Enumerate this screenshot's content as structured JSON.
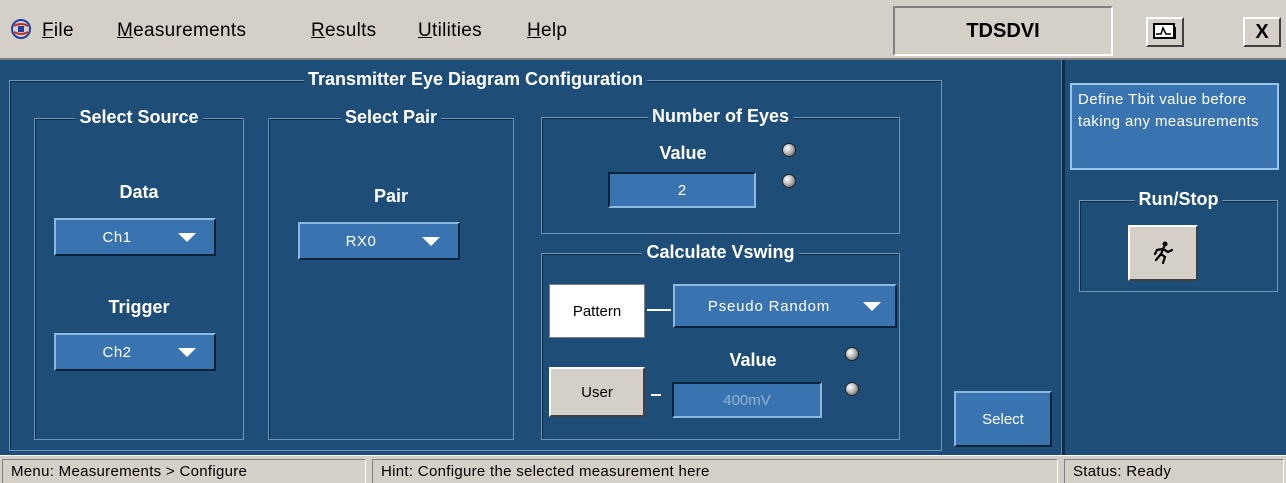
{
  "menu": {
    "items": [
      {
        "underline": "F",
        "rest": "ile"
      },
      {
        "underline": "M",
        "rest": "easurements"
      },
      {
        "underline": "R",
        "rest": "esults"
      },
      {
        "underline": "U",
        "rest": "tilities"
      },
      {
        "underline": "H",
        "rest": "elp"
      }
    ],
    "app_title": "TDSDVI",
    "close_label": "X"
  },
  "main": {
    "config_title": "Transmitter Eye Diagram Configuration",
    "select_source": {
      "title": "Select Source",
      "data_label": "Data",
      "data_value": "Ch1",
      "trigger_label": "Trigger",
      "trigger_value": "Ch2"
    },
    "select_pair": {
      "title": "Select Pair",
      "pair_label": "Pair",
      "pair_value": "RX0"
    },
    "number_of_eyes": {
      "title": "Number of Eyes",
      "value_label": "Value",
      "value": "2"
    },
    "calculate_vswing": {
      "title": "Calculate Vswing",
      "pattern_label": "Pattern",
      "pattern_value": "Pseudo Random",
      "user_label": "User",
      "value_label": "Value",
      "value": "400mV"
    },
    "select_button": "Select"
  },
  "side": {
    "info_text": "Define Tbit value before taking any measurements",
    "run_stop_title": "Run/Stop"
  },
  "status": {
    "menu_path": "Menu: Measurements > Configure",
    "hint": "Hint: Configure the selected measurement here",
    "status": "Status: Ready"
  },
  "colors": {
    "panel": "#1e4e78",
    "control": "#3a74b0",
    "chrome": "#d4d0c8"
  }
}
